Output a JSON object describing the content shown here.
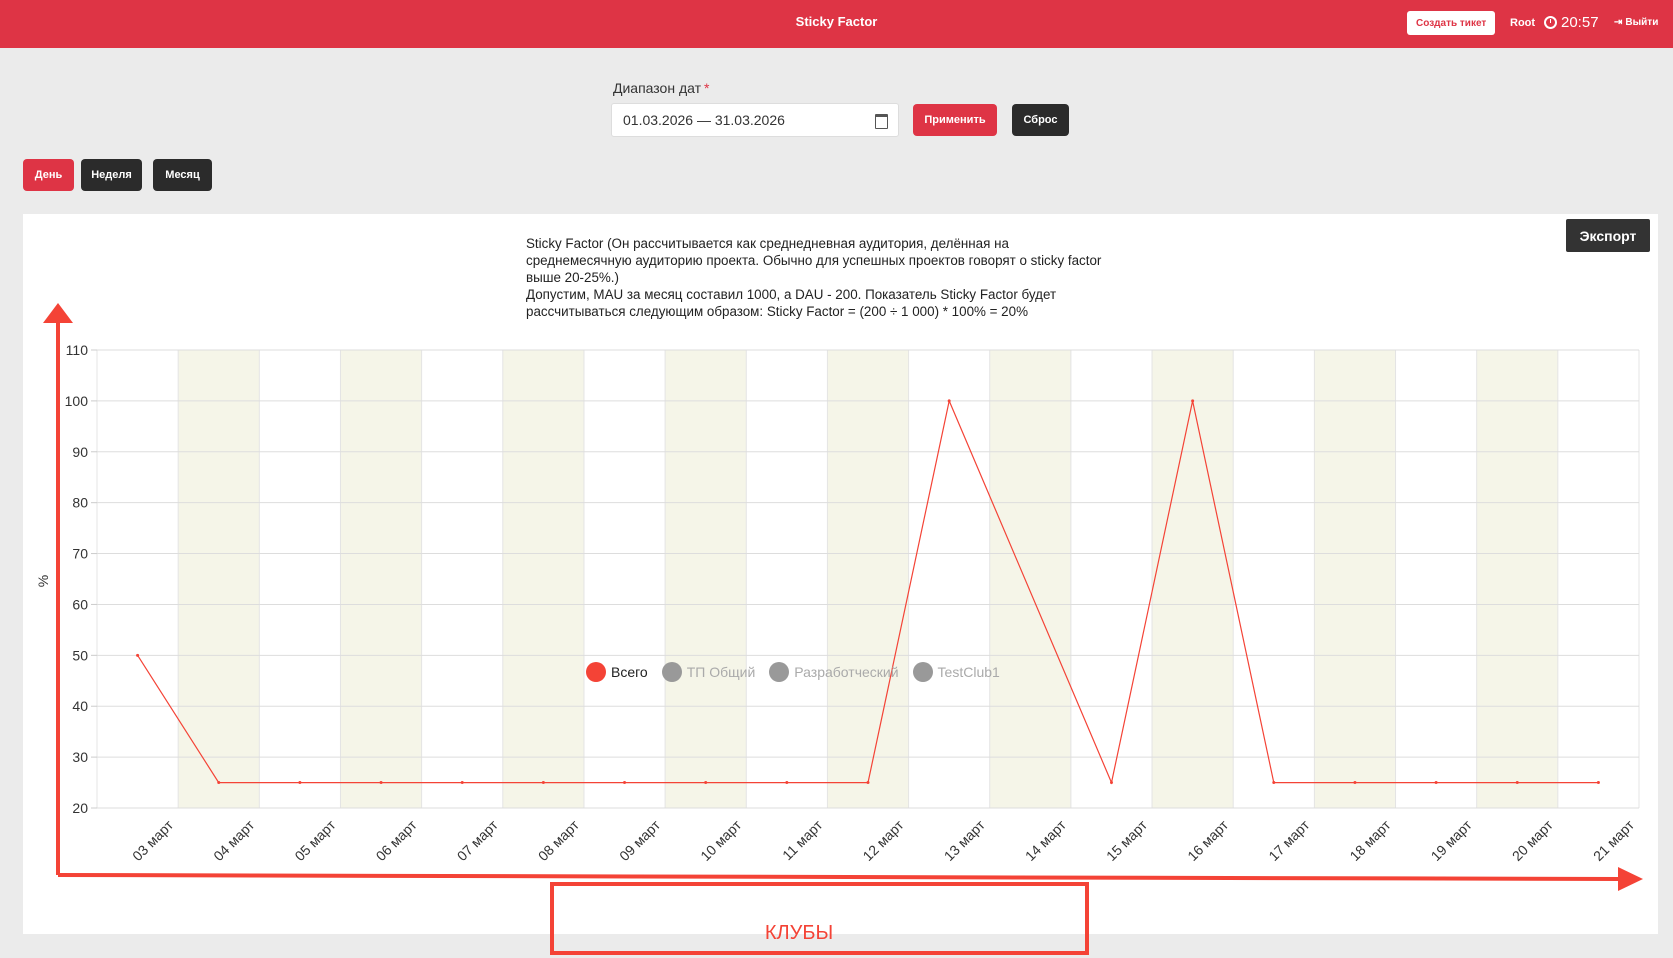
{
  "header": {
    "title": "Sticky Factor",
    "ticket_label": "Создать тикет",
    "user": "Root",
    "time": "20:57",
    "logout_label": "Выйти"
  },
  "filters": {
    "range_label": "Диапазон дат",
    "required_mark": "*",
    "range_value": "01.03.2026 — 31.03.2026",
    "apply_label": "Применить",
    "reset_label": "Сброс"
  },
  "period": {
    "day": "День",
    "week": "Неделя",
    "month": "Месяц",
    "active": "day"
  },
  "export_label": "Экспорт",
  "chart_note": [
    "Sticky Factor (Он рассчитывается как среднедневная аудитория, делённая на",
    "среднемесячную аудиторию проекта. Обычно для успешных проектов говорят о sticky factor",
    "выше 20-25%.)",
    "Допустим, MAU за месяц составил 1000, а DAU - 200. Показатель Sticky Factor будет",
    "рассчитываться следующим образом: Sticky Factor = (200 ÷ 1 000) * 100% = 20%"
  ],
  "annotation": {
    "clubs_label": "КЛУБЫ",
    "color": "#f44336"
  },
  "colors": {
    "accent": "#de3445",
    "line": "#f44336",
    "band": "#f5f5e8"
  },
  "chart_data": {
    "type": "line",
    "ylabel": "%",
    "xlabel": "",
    "ylim": [
      20,
      110
    ],
    "yticks": [
      110,
      100,
      90,
      80,
      70,
      60,
      50,
      40,
      30,
      20
    ],
    "categories": [
      "03 март",
      "04 март",
      "05 март",
      "06 март",
      "07 март",
      "08 март",
      "09 март",
      "10 март",
      "11 март",
      "12 март",
      "13 март",
      "14 март",
      "15 март",
      "16 март",
      "17 март",
      "18 март",
      "19 март",
      "20 март",
      "21 март"
    ],
    "series": [
      {
        "name": "Всего",
        "visible": true,
        "values": [
          50,
          25,
          25,
          25,
          25,
          25,
          25,
          25,
          25,
          25,
          100,
          null,
          25,
          100,
          25,
          25,
          25,
          25,
          25
        ]
      },
      {
        "name": "ТП Общий",
        "visible": false,
        "values": []
      },
      {
        "name": "Разработческий",
        "visible": false,
        "values": []
      },
      {
        "name": "TestClub1",
        "visible": false,
        "values": []
      }
    ],
    "grid": true,
    "alternating_bands": true,
    "legend_position": "bottom"
  }
}
